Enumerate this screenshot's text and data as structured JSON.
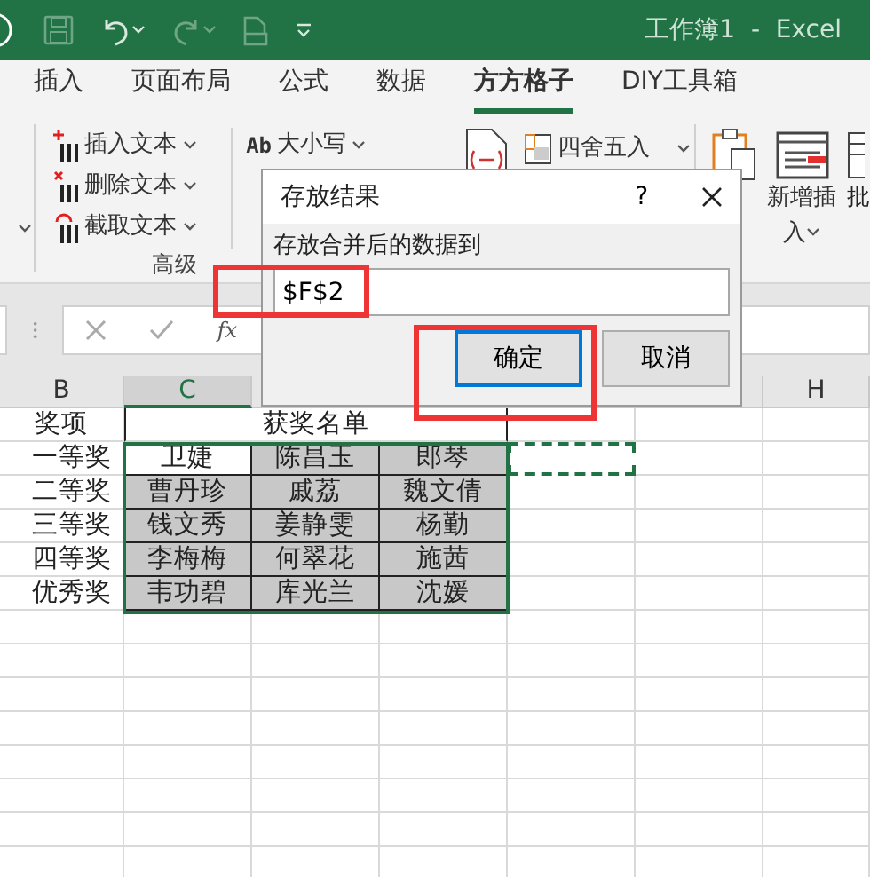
{
  "title_bar": {
    "title": "工作簿1  -  Excel"
  },
  "tabs": [
    {
      "label": "插入",
      "selected": false
    },
    {
      "label": "页面布局",
      "selected": false
    },
    {
      "label": "公式",
      "selected": false
    },
    {
      "label": "数据",
      "selected": false
    },
    {
      "label": "方方格子",
      "selected": true
    },
    {
      "label": "DIY工具箱",
      "selected": false
    }
  ],
  "ribbon": {
    "text_tools": [
      {
        "label": "插入文本",
        "kind": "insert"
      },
      {
        "label": "删除文本",
        "kind": "delete"
      },
      {
        "label": "截取文本",
        "kind": "extract"
      }
    ],
    "case_tool": {
      "icon_text": "Ab",
      "label": "大小写"
    },
    "group_label": "高级",
    "round_tool": "四舍五入",
    "new_insert": [
      "新增插",
      "入"
    ],
    "batch_fragment": "批"
  },
  "formula_bar": {
    "function_label": "fx"
  },
  "columns": [
    {
      "label": "B",
      "selected": false
    },
    {
      "label": "C",
      "selected": true
    },
    {
      "label": "H",
      "selected": false
    }
  ],
  "sheet": {
    "header": {
      "award": "奖项",
      "title": "获奖名单"
    },
    "rows": [
      {
        "award": "一等奖",
        "copy_marquee": true,
        "names": [
          {
            "text": "卫婕",
            "active": true
          },
          {
            "text": "陈昌玉",
            "active": false
          },
          {
            "text": "郎琴",
            "active": false
          }
        ]
      },
      {
        "award": "二等奖",
        "copy_marquee": false,
        "names": [
          {
            "text": "曹丹珍",
            "active": false
          },
          {
            "text": "戚荔",
            "active": false
          },
          {
            "text": "魏文倩",
            "active": false
          }
        ]
      },
      {
        "award": "三等奖",
        "copy_marquee": false,
        "names": [
          {
            "text": "钱文秀",
            "active": false
          },
          {
            "text": "姜静雯",
            "active": false
          },
          {
            "text": "杨勤",
            "active": false
          }
        ]
      },
      {
        "award": "四等奖",
        "copy_marquee": false,
        "names": [
          {
            "text": "李梅梅",
            "active": false
          },
          {
            "text": "何翠花",
            "active": false
          },
          {
            "text": "施茜",
            "active": false
          }
        ]
      },
      {
        "award": "优秀奖",
        "copy_marquee": false,
        "names": [
          {
            "text": "韦功碧",
            "active": false
          },
          {
            "text": "库光兰",
            "active": false
          },
          {
            "text": "沈媛",
            "active": false
          }
        ]
      }
    ]
  },
  "dialog": {
    "title": "存放结果",
    "help": "?",
    "label": "存放合并后的数据到",
    "field": {
      "value": "$F$2",
      "highlighted": true
    },
    "buttons": [
      {
        "label": "确定",
        "default": true,
        "highlighted": true
      },
      {
        "label": "取消",
        "default": false,
        "highlighted": false
      }
    ]
  }
}
